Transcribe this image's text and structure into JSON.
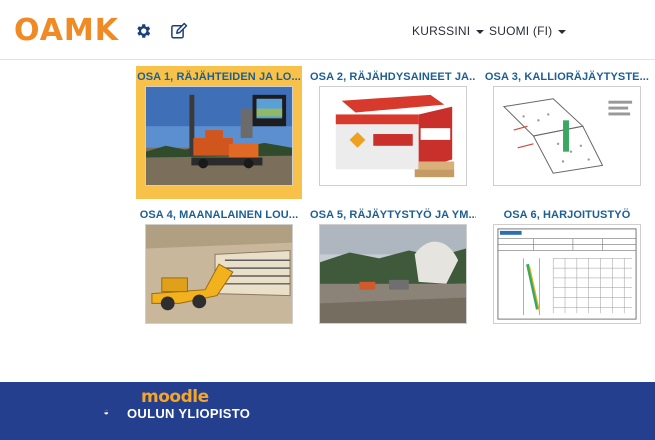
{
  "header": {
    "logo": "OAMK",
    "course_menu": "KURSSINI",
    "language_menu": "SUOMI (FI)"
  },
  "colors": {
    "brand_orange": "#f08a24",
    "footer_blue": "#233f8e",
    "tile_title": "#1d5e93",
    "selected_tile": "#f8c24a"
  },
  "tiles": [
    {
      "title": "OSA 1, RÄJÄHTEIDEN JA LO...",
      "image_icon": "drilling-rig-photo",
      "selected": true
    },
    {
      "title": "OSA 2, RÄJÄHDYSAINEET JA...",
      "image_icon": "explosives-package-photo"
    },
    {
      "title": "OSA 3, KALLIORÄJÄYTYSTE...",
      "image_icon": "rock-blasting-diagram"
    },
    {
      "title": "OSA 4, MAANALAINEN LOU...",
      "image_icon": "underground-loader-illustration"
    },
    {
      "title": "OSA 5, RÄJÄYTYSTYÖ JA YM...",
      "image_icon": "blasting-site-photo"
    },
    {
      "title": "OSA 6, HARJOITUSTYÖ",
      "image_icon": "exercise-form-document"
    }
  ],
  "footer": {
    "moodle": "moodle",
    "university": "OULUN YLIOPISTO"
  }
}
